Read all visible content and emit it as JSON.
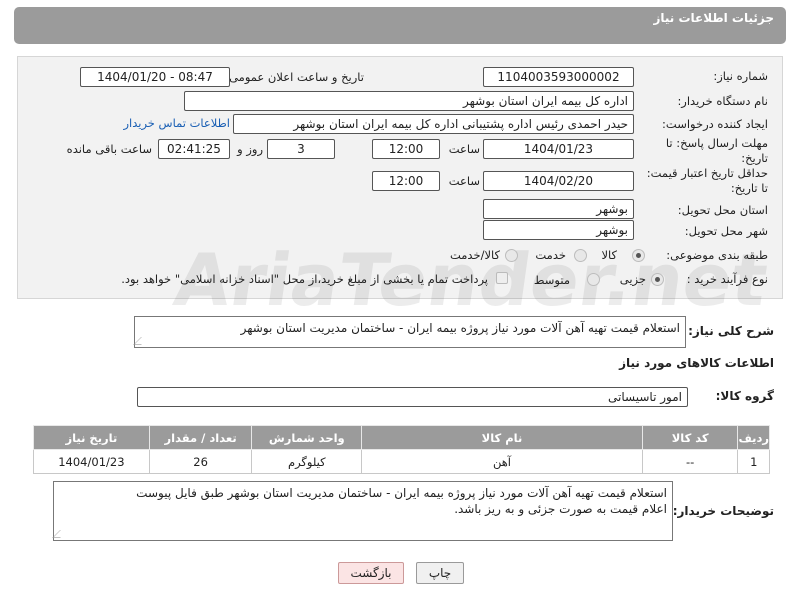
{
  "header": {
    "title": "جزئیات اطلاعات نیاز"
  },
  "fields": {
    "need_number_label": "شماره نیاز:",
    "need_number": "1104003593000002",
    "announce_label": "تاریخ و ساعت اعلان عمومی:",
    "announce_value": "1404/01/20 - 08:47",
    "buyer_label": "نام دستگاه خریدار:",
    "buyer_value": "اداره کل بیمه ایران استان بوشهر",
    "creator_label": "ایجاد کننده درخواست:",
    "creator_value": "حیدر احمدی رئیس اداره پشتیبانی اداره کل بیمه ایران استان بوشهر",
    "contact_link": "اطلاعات تماس خریدار",
    "deadline_label_1": "مهلت ارسال پاسخ: تا",
    "deadline_label_2": "تاریخ:",
    "deadline_date": "1404/01/23",
    "time_label": "ساعت",
    "deadline_time": "12:00",
    "days_value": "3",
    "days_label": "روز و",
    "remaining_time": "02:41:25",
    "remaining_label": "ساعت باقی مانده",
    "price_label_1": "حداقل تاریخ اعتبار قیمت:",
    "price_label_2": "تا تاریخ:",
    "price_date": "1404/02/20",
    "price_time": "12:00",
    "province_label": "استان محل تحویل:",
    "province_value": "بوشهر",
    "city_label": "شهر محل تحویل:",
    "city_value": "بوشهر",
    "category_label": "طبقه بندی موضوعی:",
    "category_options": [
      "کالا",
      "خدمت",
      "کالا/خدمت"
    ],
    "category_selected": "کالا",
    "process_label": "نوع فرآیند خرید :",
    "process_options": [
      "جزیی",
      "متوسط"
    ],
    "process_selected": "جزیی",
    "payment_note": "پرداخت تمام یا بخشی از مبلغ خرید،از محل \"اسناد خزانه اسلامی\" خواهد بود."
  },
  "description": {
    "label": "شرح کلی نیاز:",
    "value": "استعلام قیمت تهیه آهن آلات مورد نیاز پروژه بیمه ایران - ساختمان مدیریت استان بوشهر"
  },
  "goods": {
    "section_title": "اطلاعات کالاهای مورد نیاز",
    "group_label": "گروه کالا:",
    "group_value": "امور تاسیساتی",
    "columns": [
      "ردیف",
      "کد کالا",
      "نام کالا",
      "واحد شمارش",
      "تعداد / مقدار",
      "تاریخ نیاز"
    ],
    "rows": [
      [
        "1",
        "--",
        "آهن",
        "کیلوگرم",
        "26",
        "1404/01/23"
      ]
    ]
  },
  "buyer_notes": {
    "label": "توضیحات خریدار:",
    "line1": "استعلام قیمت تهیه آهن آلات مورد نیاز پروژه بیمه ایران - ساختمان مدیریت استان بوشهر طبق فایل پیوست",
    "line2": "اعلام قیمت به صورت جزئی و به ریز باشد."
  },
  "buttons": {
    "print": "چاپ",
    "back": "بازگشت"
  },
  "watermark": "AriaTender.net",
  "colors": {
    "header": "#9b9b9b",
    "link": "#1a5fb4",
    "back_button": "#fbe4e4"
  }
}
